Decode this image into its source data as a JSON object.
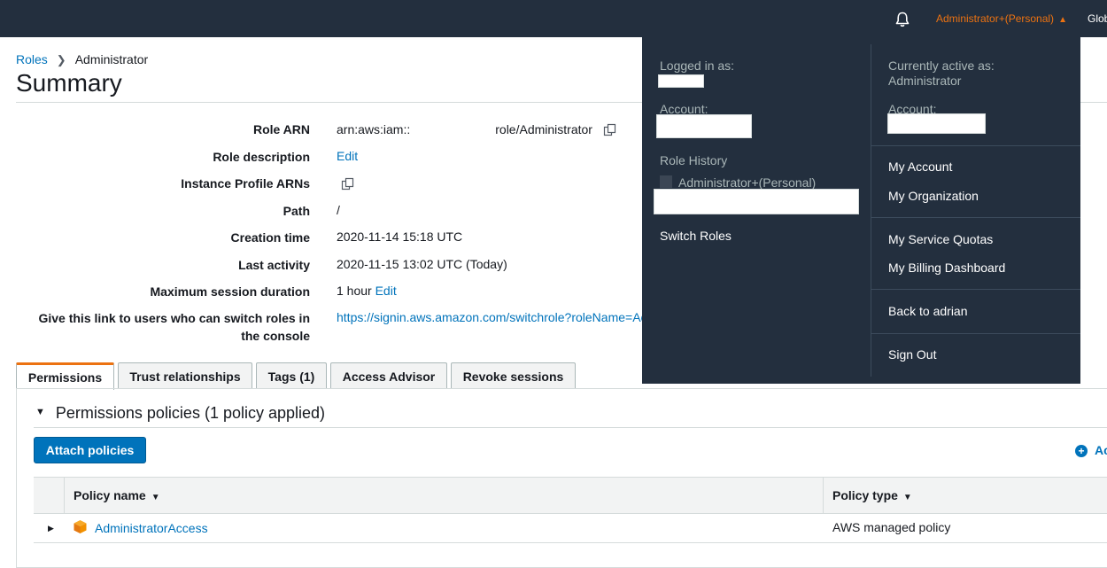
{
  "topbar": {
    "account_menu": "Administrator+(Personal)",
    "global_label": "Glob",
    "bell_icon": "bell-icon"
  },
  "breadcrumb": {
    "parent": "Roles",
    "current": "Administrator"
  },
  "page_title": "Summary",
  "summary": {
    "role_arn": {
      "label": "Role ARN",
      "prefix": "arn:aws:iam::",
      "suffix": "role/Administrator"
    },
    "role_description": {
      "label": "Role description",
      "value": "Edit"
    },
    "instance_profile_arns": {
      "label": "Instance Profile ARNs"
    },
    "path": {
      "label": "Path",
      "value": "/"
    },
    "creation_time": {
      "label": "Creation time",
      "value": "2020-11-14 15:18 UTC"
    },
    "last_activity": {
      "label": "Last activity",
      "value": "2020-11-15 13:02 UTC (Today)"
    },
    "max_session": {
      "label": "Maximum session duration",
      "value": "1 hour",
      "edit": "Edit"
    },
    "switch_link": {
      "label_line1": "Give this link to users who can switch roles in",
      "label_line2": "the console",
      "value": "https://signin.aws.amazon.com/switchrole?roleName=Ac"
    }
  },
  "tabs": [
    {
      "label": "Permissions",
      "active": true
    },
    {
      "label": "Trust relationships"
    },
    {
      "label": "Tags (1)"
    },
    {
      "label": "Access Advisor"
    },
    {
      "label": "Revoke sessions"
    }
  ],
  "permissions": {
    "heading": "Permissions policies (1 policy applied)",
    "attach_button": "Attach policies",
    "add_inline": "Ac",
    "columns": [
      "Policy name",
      "Policy type"
    ],
    "rows": [
      {
        "name": "AdministratorAccess",
        "type": "AWS managed policy"
      }
    ]
  },
  "dropdown": {
    "logged_in_as": "Logged in as:",
    "account_label_left": "Account:",
    "role_history_label": "Role History",
    "role_history_item": "Administrator+(Personal)",
    "switch_roles": "Switch Roles",
    "currently_active_label": "Currently active as:",
    "currently_active_value": "Administrator",
    "account_label_right": "Account:",
    "menu_group_1": [
      "My Account",
      "My Organization"
    ],
    "menu_group_2": [
      "My Service Quotas",
      "My Billing Dashboard"
    ],
    "back_to": "Back to adrian",
    "sign_out": "Sign Out"
  },
  "colors": {
    "nav_bg": "#232f3e",
    "accent_orange": "#ec7211",
    "link_blue": "#0073bb"
  }
}
